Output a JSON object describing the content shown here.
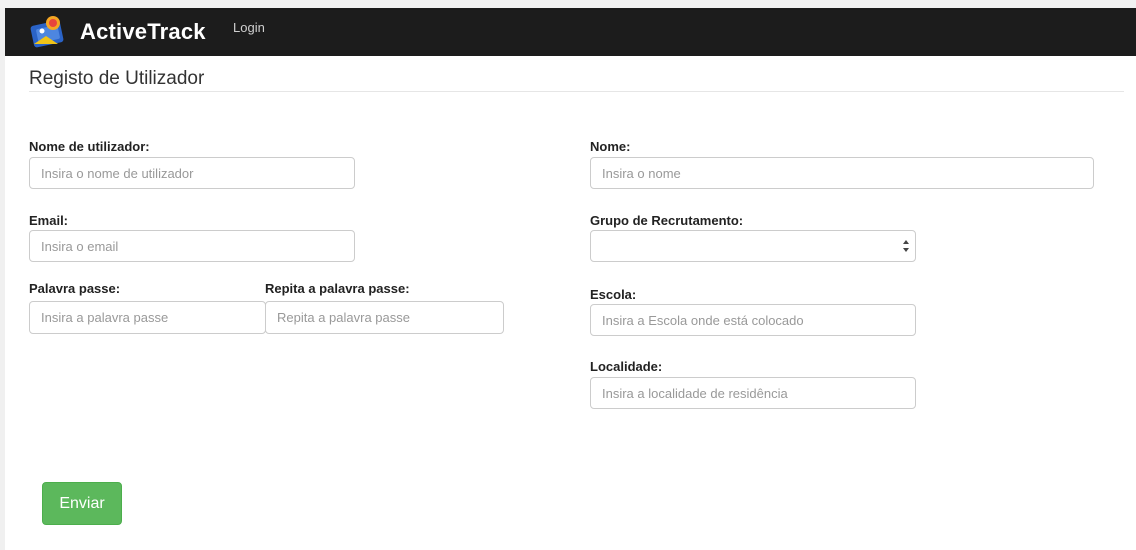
{
  "header": {
    "brand": "ActiveTrack",
    "login_label": "Login",
    "logo_icon": "activetrack-logo-icon"
  },
  "page": {
    "title": "Registo de Utilizador"
  },
  "form": {
    "username": {
      "label": "Nome de utilizador:",
      "placeholder": "Insira o nome de utilizador",
      "value": ""
    },
    "email": {
      "label": "Email:",
      "placeholder": "Insira o email",
      "value": ""
    },
    "password": {
      "label": "Palavra passe:",
      "placeholder": "Insira a palavra passe",
      "value": ""
    },
    "password_repeat": {
      "label": "Repita a palavra passe:",
      "placeholder": "Repita a palavra passe",
      "value": ""
    },
    "name": {
      "label": "Nome:",
      "placeholder": "Insira o nome",
      "value": ""
    },
    "recruitment_group": {
      "label": "Grupo de Recrutamento:",
      "selected": ""
    },
    "school": {
      "label": "Escola:",
      "placeholder": "Insira a Escola onde está colocado",
      "value": ""
    },
    "locality": {
      "label": "Localidade:",
      "placeholder": "Insira a localidade de residência",
      "value": ""
    },
    "submit_label": "Enviar"
  },
  "colors": {
    "navbar": "#1c1c1c",
    "submit": "#5cb85c"
  }
}
